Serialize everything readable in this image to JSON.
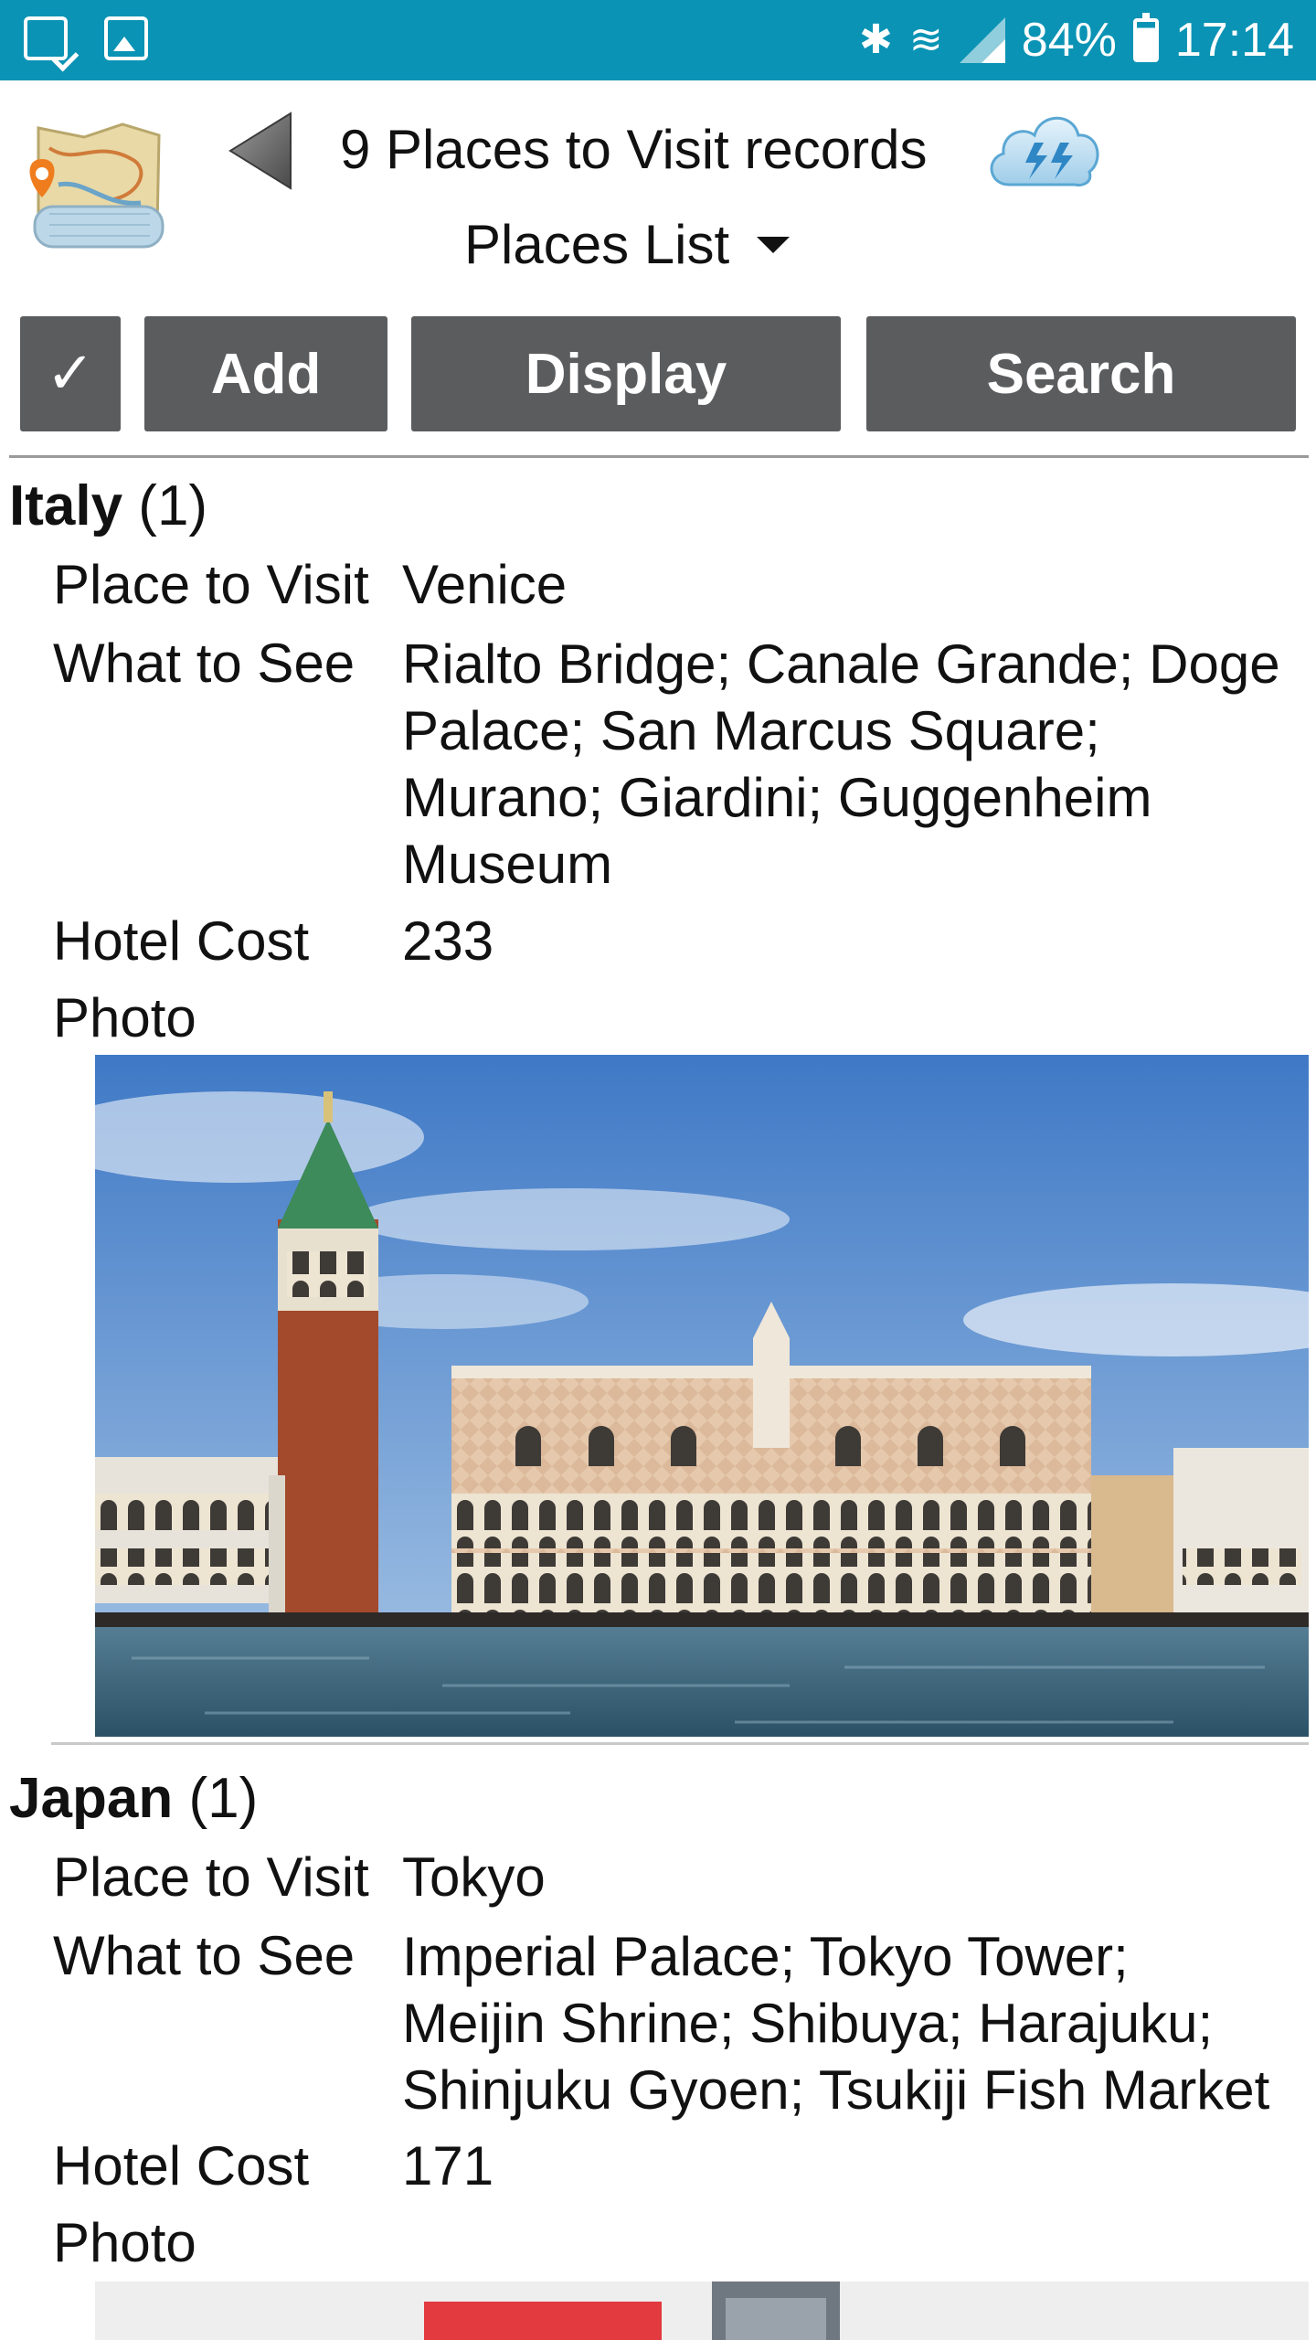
{
  "status_bar": {
    "left_icons": [
      "tablet-check-icon",
      "image-icon"
    ],
    "bluetooth_glyph": "✱",
    "wifi_glyph": "≋",
    "battery": "84%",
    "time": "17:14"
  },
  "header": {
    "title": "9 Places to Visit records",
    "view": "Places List",
    "logo_icon": "map-logo-icon",
    "back_icon": "back-arrow-icon",
    "sync_icon": "cloud-sync-icon"
  },
  "toolbar": {
    "check_label": "✓",
    "add_label": "Add",
    "display_label": "Display",
    "search_label": "Search"
  },
  "groups": [
    {
      "name": "Italy",
      "count": "(1)",
      "records": [
        {
          "place_label": "Place to Visit",
          "place": "Venice",
          "see_label": "What to See",
          "see_lines": [
            "Rialto Bridge; Canale Grande; Doge",
            "Palace; San Marcus Square;",
            "Murano; Giardini; Guggenheim",
            "Museum"
          ],
          "hotel_label": "Hotel Cost",
          "hotel_cost": "233",
          "photo_label": "Photo"
        }
      ]
    },
    {
      "name": "Japan",
      "count": "(1)",
      "records": [
        {
          "place_label": "Place to Visit",
          "place": "Tokyo",
          "see_label": "What to See",
          "see_lines": [
            "Imperial Palace; Tokyo Tower;",
            "Meijin Shrine; Shibuya; Harajuku;",
            "Shinjuku Gyoen; Tsukiji Fish Market"
          ],
          "hotel_label": "Hotel Cost",
          "hotel_cost": "171",
          "photo_label": "Photo"
        }
      ]
    }
  ],
  "colors": {
    "status_bar": "#0a93b4",
    "button_bg": "#5b5c5e",
    "button_text": "#ffffff"
  }
}
